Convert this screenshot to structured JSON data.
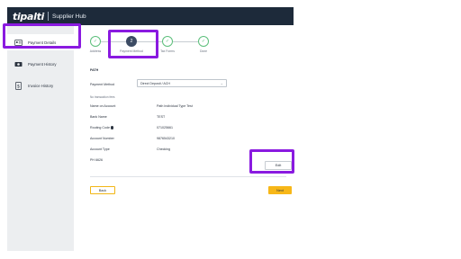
{
  "header": {
    "logo_text": "tipalti",
    "title": "Supplier Hub"
  },
  "sidebar": {
    "items": [
      {
        "label": "Payment Details",
        "icon": "id-card-icon",
        "active": true
      },
      {
        "label": "Payment History",
        "icon": "money-icon",
        "active": false
      },
      {
        "label": "Invoice History",
        "icon": "invoice-dollar-icon",
        "active": false
      }
    ]
  },
  "steps": [
    {
      "label": "Address",
      "state": "done",
      "glyph": "✓"
    },
    {
      "label": "Payment Method",
      "state": "current",
      "glyph": "2"
    },
    {
      "label": "Tax Forms",
      "state": "done",
      "glyph": "✓"
    },
    {
      "label": "Done",
      "state": "done",
      "glyph": "✓"
    }
  ],
  "form": {
    "section_title": "PATH",
    "payment_method_label": "Payment Method",
    "payment_method_value": "Direct Deposit / ACH",
    "fees_note": "No transaction fees",
    "fields": [
      {
        "label": "Name on Account",
        "value": "Path Individual Type Test"
      },
      {
        "label": "Bank Name",
        "value": "TEST"
      },
      {
        "label": "Routing Code",
        "value": "071025661"
      },
      {
        "label": "Account Number",
        "value": "9876543210"
      },
      {
        "label": "Account Type",
        "value": "Checking"
      }
    ],
    "account_id": "PH 6626"
  },
  "buttons": {
    "edit": "Edit",
    "back": "Back",
    "next": "Next"
  },
  "colors": {
    "topbar": "#1d2a3a",
    "accent_yellow": "#f7b718",
    "step_done": "#5cbf7b",
    "step_current": "#3c4b63",
    "highlight": "#8a1ae0"
  }
}
